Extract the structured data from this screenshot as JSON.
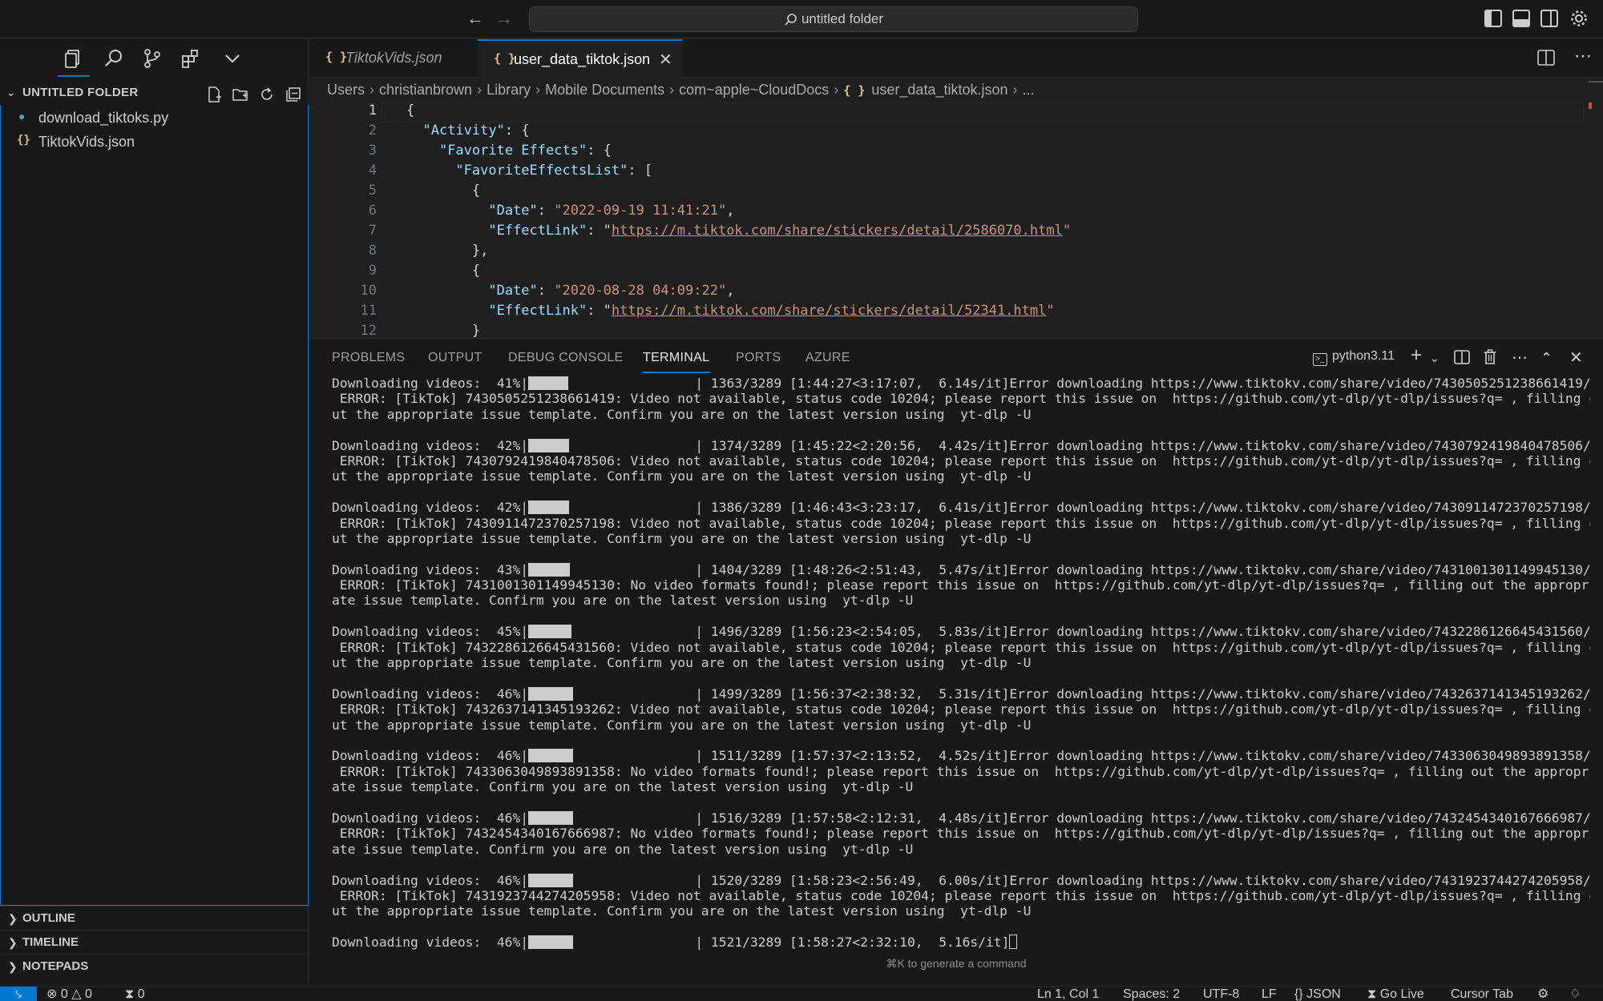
{
  "titlebar": {
    "search_text": "untitled folder"
  },
  "sidebar": {
    "explorer_title": "UNTITLED FOLDER",
    "files": [
      {
        "name": "download_tiktoks.py",
        "icon": "python-file-icon"
      },
      {
        "name": "TiktokVids.json",
        "icon": "json-file-icon"
      }
    ],
    "sections": [
      {
        "label": "OUTLINE"
      },
      {
        "label": "TIMELINE"
      },
      {
        "label": "NOTEPADS"
      }
    ]
  },
  "editor": {
    "tabs": [
      {
        "icon": "{ }",
        "label": "TiktokVids.json"
      },
      {
        "icon": "{ }",
        "label": "user_data_tiktok.json"
      }
    ],
    "breadcrumb": [
      "Users",
      "christianbrown",
      "Library",
      "Mobile Documents",
      "com~apple~CloudDocs",
      "user_data_tiktok.json",
      "..."
    ],
    "breadcrumb_json_icon": "{ }",
    "lines": [
      {
        "n": "1",
        "text": "{"
      },
      {
        "n": "2",
        "indent": "  ",
        "key": "\"Activity\"",
        "rest": ": {"
      },
      {
        "n": "3",
        "indent": "    ",
        "key": "\"Favorite Effects\"",
        "rest": ": {"
      },
      {
        "n": "4",
        "indent": "      ",
        "key": "\"FavoriteEffectsList\"",
        "rest": ": ["
      },
      {
        "n": "5",
        "text": "        {"
      },
      {
        "n": "6",
        "indent": "          ",
        "key": "\"Date\"",
        "rest": ": ",
        "str": "\"2022-09-19 11:41:21\"",
        "tail": ","
      },
      {
        "n": "7",
        "indent": "          ",
        "key": "\"EffectLink\"",
        "rest": ": \"",
        "url": "https://m.tiktok.com/share/stickers/detail/2586070.html",
        "tail": "\""
      },
      {
        "n": "8",
        "text": "        },"
      },
      {
        "n": "9",
        "text": "        {"
      },
      {
        "n": "10",
        "indent": "          ",
        "key": "\"Date\"",
        "rest": ": ",
        "str": "\"2020-08-28 04:09:22\"",
        "tail": ","
      },
      {
        "n": "11",
        "indent": "          ",
        "key": "\"EffectLink\"",
        "rest": ": \"",
        "url": "https://m.tiktok.com/share/stickers/detail/52341.html",
        "tail": "\""
      },
      {
        "n": "12",
        "text": "        }"
      }
    ]
  },
  "panel": {
    "tabs": [
      "PROBLEMS",
      "OUTPUT",
      "DEBUG CONSOLE",
      "TERMINAL",
      "PORTS",
      "AZURE"
    ],
    "active_tab": "TERMINAL",
    "terminal_name": "python3.11",
    "generate_hint": "⌘K to generate a command",
    "terminal_entries": [
      {
        "pct": "41%",
        "progress": 0.41,
        "stats": "| 1363/3289 [1:44:27<3:17:07,  6.14s/it]Error downloading https://www.tiktokv.com/share/video/7430505251238661419/:",
        "err1": " ERROR: [TikTok] 7430505251238661419: Video not available, status code 10204; please report this issue on  https://github.com/yt-dlp/yt-dlp/issues?q= , filling o",
        "err2": "ut the appropriate issue template. Confirm you are on the latest version using  yt-dlp -U"
      },
      {
        "pct": "42%",
        "progress": 0.42,
        "stats": "| 1374/3289 [1:45:22<2:20:56,  4.42s/it]Error downloading https://www.tiktokv.com/share/video/7430792419840478506/:",
        "err1": " ERROR: [TikTok] 7430792419840478506: Video not available, status code 10204; please report this issue on  https://github.com/yt-dlp/yt-dlp/issues?q= , filling o",
        "err2": "ut the appropriate issue template. Confirm you are on the latest version using  yt-dlp -U"
      },
      {
        "pct": "42%",
        "progress": 0.42,
        "stats": "| 1386/3289 [1:46:43<3:23:17,  6.41s/it]Error downloading https://www.tiktokv.com/share/video/7430911472370257198/:",
        "err1": " ERROR: [TikTok] 7430911472370257198: Video not available, status code 10204; please report this issue on  https://github.com/yt-dlp/yt-dlp/issues?q= , filling o",
        "err2": "ut the appropriate issue template. Confirm you are on the latest version using  yt-dlp -U"
      },
      {
        "pct": "43%",
        "progress": 0.43,
        "stats": "| 1404/3289 [1:48:26<2:51:43,  5.47s/it]Error downloading https://www.tiktokv.com/share/video/7431001301149945130/:",
        "err1": " ERROR: [TikTok] 7431001301149945130: No video formats found!; please report this issue on  https://github.com/yt-dlp/yt-dlp/issues?q= , filling out the appropri",
        "err2": "ate issue template. Confirm you are on the latest version using  yt-dlp -U"
      },
      {
        "pct": "45%",
        "progress": 0.45,
        "stats": "| 1496/3289 [1:56:23<2:54:05,  5.83s/it]Error downloading https://www.tiktokv.com/share/video/7432286126645431560/:",
        "err1": " ERROR: [TikTok] 7432286126645431560: Video not available, status code 10204; please report this issue on  https://github.com/yt-dlp/yt-dlp/issues?q= , filling o",
        "err2": "ut the appropriate issue template. Confirm you are on the latest version using  yt-dlp -U"
      },
      {
        "pct": "46%",
        "progress": 0.46,
        "stats": "| 1499/3289 [1:56:37<2:38:32,  5.31s/it]Error downloading https://www.tiktokv.com/share/video/7432637141345193262/:",
        "err1": " ERROR: [TikTok] 7432637141345193262: Video not available, status code 10204; please report this issue on  https://github.com/yt-dlp/yt-dlp/issues?q= , filling o",
        "err2": "ut the appropriate issue template. Confirm you are on the latest version using  yt-dlp -U"
      },
      {
        "pct": "46%",
        "progress": 0.46,
        "stats": "| 1511/3289 [1:57:37<2:13:52,  4.52s/it]Error downloading https://www.tiktokv.com/share/video/7433063049893891358/:",
        "err1": " ERROR: [TikTok] 7433063049893891358: No video formats found!; please report this issue on  https://github.com/yt-dlp/yt-dlp/issues?q= , filling out the appropri",
        "err2": "ate issue template. Confirm you are on the latest version using  yt-dlp -U"
      },
      {
        "pct": "46%",
        "progress": 0.46,
        "stats": "| 1516/3289 [1:57:58<2:12:31,  4.48s/it]Error downloading https://www.tiktokv.com/share/video/7432454340167666987/:",
        "err1": " ERROR: [TikTok] 7432454340167666987: No video formats found!; please report this issue on  https://github.com/yt-dlp/yt-dlp/issues?q= , filling out the appropri",
        "err2": "ate issue template. Confirm you are on the latest version using  yt-dlp -U"
      },
      {
        "pct": "46%",
        "progress": 0.46,
        "stats": "| 1520/3289 [1:58:23<2:56:49,  6.00s/it]Error downloading https://www.tiktokv.com/share/video/7431923744274205958/:",
        "err1": " ERROR: [TikTok] 7431923744274205958: Video not available, status code 10204; please report this issue on  https://github.com/yt-dlp/yt-dlp/issues?q= , filling o",
        "err2": "ut the appropriate issue template. Confirm you are on the latest version using  yt-dlp -U"
      }
    ],
    "last_line": {
      "pct": "46%",
      "progress": 0.46,
      "stats": "| 1521/3289 [1:58:27<2:32:10,  5.16s/it]"
    },
    "progress_prefix": "Downloading videos:  "
  },
  "statusbar": {
    "errors": "0",
    "warnings": "0",
    "ports": "0",
    "position": "Ln 1, Col 1",
    "spaces": "Spaces: 2",
    "encoding": "UTF-8",
    "eol": "LF",
    "language": "JSON",
    "golive": "Go Live",
    "cursor_tab": "Cursor Tab"
  },
  "colors": {
    "accent": "#0078d4",
    "json_key": "#9cdcfe",
    "json_string": "#ce9178",
    "json_icon": "#e2c08d"
  }
}
